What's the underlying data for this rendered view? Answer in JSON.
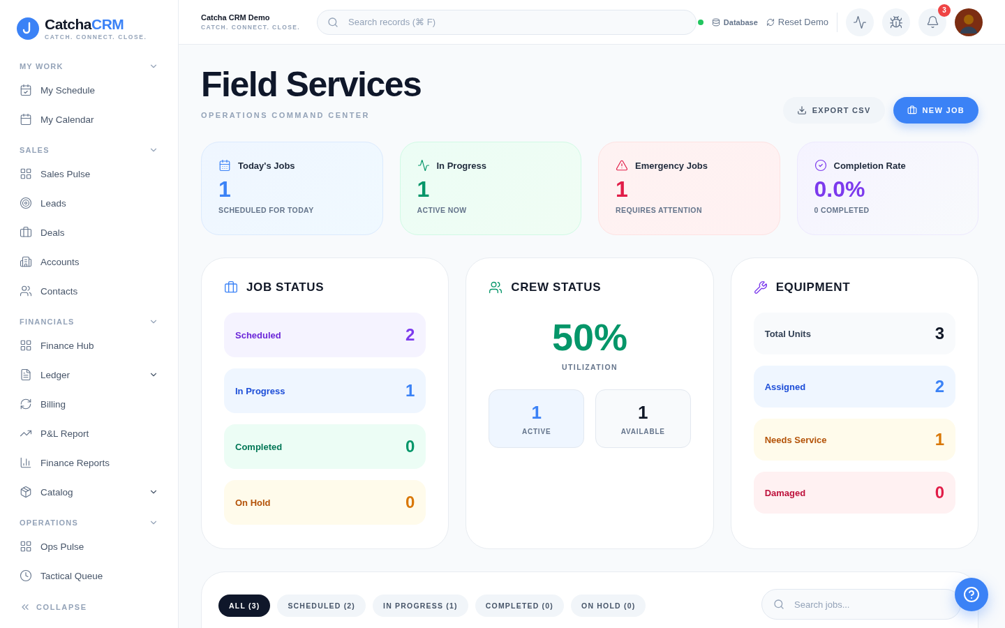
{
  "sidebar": {
    "brand": {
      "name_start": "Catcha",
      "name_end": "CRM",
      "tagline": "CATCH. CONNECT. CLOSE."
    },
    "sections": [
      {
        "title": "MY WORK",
        "expanded": true,
        "items": [
          {
            "label": "My Schedule",
            "expandable": false
          },
          {
            "label": "My Calendar",
            "expandable": false
          }
        ]
      },
      {
        "title": "SALES",
        "expanded": true,
        "items": [
          {
            "label": "Sales Pulse",
            "expandable": false
          },
          {
            "label": "Leads",
            "expandable": false
          },
          {
            "label": "Deals",
            "expandable": false
          },
          {
            "label": "Accounts",
            "expandable": false
          },
          {
            "label": "Contacts",
            "expandable": false
          }
        ]
      },
      {
        "title": "FINANCIALS",
        "expanded": true,
        "items": [
          {
            "label": "Finance Hub",
            "expandable": false
          },
          {
            "label": "Ledger",
            "expandable": true
          },
          {
            "label": "Billing",
            "expandable": false
          },
          {
            "label": "P&L Report",
            "expandable": false
          },
          {
            "label": "Finance Reports",
            "expandable": false
          },
          {
            "label": "Catalog",
            "expandable": true
          }
        ]
      },
      {
        "title": "OPERATIONS",
        "expanded": true,
        "items": [
          {
            "label": "Ops Pulse",
            "expandable": false
          },
          {
            "label": "Tactical Queue",
            "expandable": false
          }
        ]
      }
    ],
    "collapse": "COLLAPSE"
  },
  "topbar": {
    "workspace": "Catcha CRM Demo",
    "workspace_tagline": "CATCH. CONNECT. CLOSE.",
    "search": {
      "placeholder": "Search records (⌘ F)"
    },
    "database": {
      "label": "Database",
      "online": true
    },
    "reset": "Reset Demo",
    "notifications": "3"
  },
  "header": {
    "title": "Field Services",
    "subtitle": "OPERATIONS COMMAND CENTER",
    "buttons": [
      {
        "label": "EXPORT CSV",
        "kind": "secondary"
      },
      {
        "label": "NEW JOB",
        "kind": "primary"
      }
    ]
  },
  "stat_cards": [
    {
      "kind": "today",
      "label": "Today's Jobs",
      "value": "1",
      "caption": "SCHEDULED FOR TODAY"
    },
    {
      "kind": "progress",
      "label": "In Progress",
      "value": "1",
      "caption": "ACTIVE NOW"
    },
    {
      "kind": "emergency",
      "label": "Emergency Jobs",
      "value": "1",
      "caption": "REQUIRES ATTENTION"
    },
    {
      "kind": "completion",
      "label": "Completion Rate",
      "value": "0.0%",
      "caption": "0 COMPLETED"
    }
  ],
  "job_status": {
    "title": "JOB STATUS",
    "rows": [
      {
        "label": "Scheduled",
        "value": "2",
        "kind": "purple"
      },
      {
        "label": "In Progress",
        "value": "1",
        "kind": "blue"
      },
      {
        "label": "Completed",
        "value": "0",
        "kind": "green"
      },
      {
        "label": "On Hold",
        "value": "0",
        "kind": "amber"
      }
    ]
  },
  "crew_status": {
    "title": "CREW STATUS",
    "value": "50%",
    "caption": "UTILIZATION",
    "tiles": [
      {
        "value": "1",
        "label": "ACTIVE",
        "kind": "blue"
      },
      {
        "value": "1",
        "label": "AVAILABLE",
        "kind": "neutral"
      }
    ]
  },
  "equipment": {
    "title": "EQUIPMENT",
    "rows": [
      {
        "label": "Total Units",
        "value": "3",
        "kind": "neutral"
      },
      {
        "label": "Assigned",
        "value": "2",
        "kind": "blue"
      },
      {
        "label": "Needs Service",
        "value": "1",
        "kind": "amber"
      },
      {
        "label": "Damaged",
        "value": "0",
        "kind": "red"
      }
    ]
  },
  "filters": {
    "tabs": [
      {
        "label": "ALL (3)",
        "selected": true
      },
      {
        "label": "SCHEDULED (2)",
        "selected": false
      },
      {
        "label": "IN PROGRESS (1)",
        "selected": false
      },
      {
        "label": "COMPLETED (0)",
        "selected": false
      },
      {
        "label": "ON HOLD (0)",
        "selected": false
      }
    ],
    "search": {
      "placeholder": "Search jobs..."
    }
  }
}
